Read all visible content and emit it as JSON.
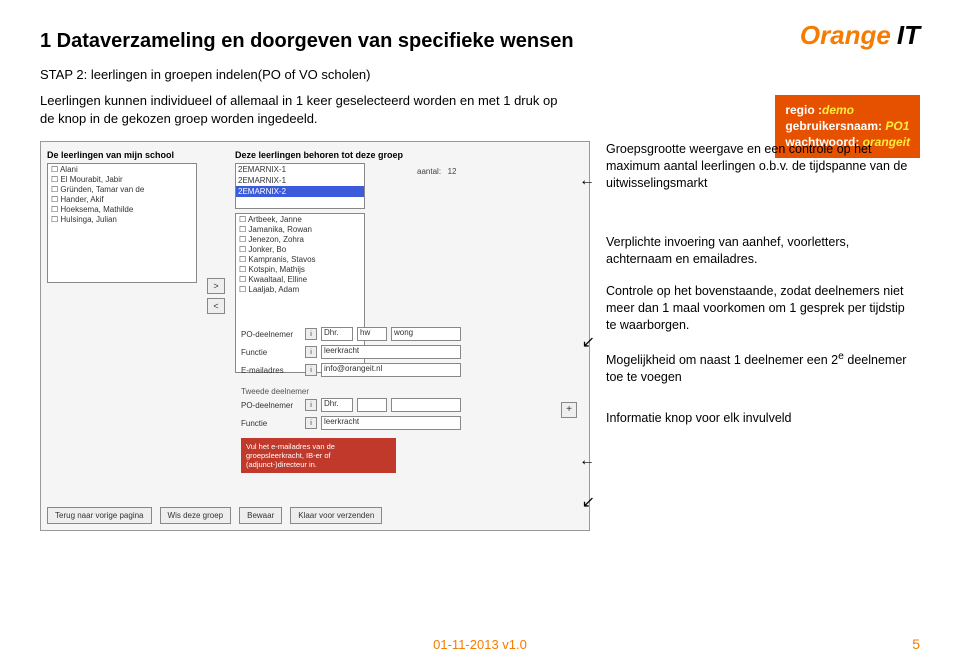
{
  "title": "1 Dataverzameling en doorgeven van specifieke wensen",
  "logo": {
    "orange": "Orange",
    "it": "IT"
  },
  "step": "STAP 2: leerlingen in groepen indelen(PO of VO scholen)",
  "intro": "Leerlingen kunnen individueel of allemaal in 1 keer geselecteerd worden en met 1 druk op de knop in de gekozen groep worden ingedeeld.",
  "region": {
    "line1_label": "regio :",
    "line1_val": "demo",
    "line2_label": "gebruikersnaam:",
    "line2_val": "PO1",
    "line3_label": "wachtwoord:",
    "line3_val": "orangeit"
  },
  "screenshot": {
    "left_label": "De leerlingen van mijn school",
    "right_label": "Deze leerlingen behoren tot deze groep",
    "left_list": [
      "Alani",
      "El Mourabit, Jabir",
      "Gründen, Tamar van de",
      "Hander, Akif",
      "Hoeksema, Mathilde",
      "Hulsinga, Julian"
    ],
    "group_list": [
      "2EMARNIX-1",
      "2EMARNIX-1",
      "2EMARNIX-2"
    ],
    "aantal_label": "aantal:",
    "aantal_val": "12",
    "right_list": [
      "Artbeek, Janne",
      "Jamanika, Rowan",
      "Jenezon, Zohra",
      "Jonker, Bo",
      "Kampranis, Stavos",
      "Kotspin, Mathijs",
      "Kwaaltaal, Elline",
      "Laaljab, Adam"
    ],
    "btn_right": ">",
    "btn_left": "<",
    "form": {
      "row1_label": "PO-deelnemer",
      "row1_sel": "Dhr.",
      "row1_v1": "hw",
      "row1_v2": "wong",
      "row2_label": "Functie",
      "row2_val": "leerkracht",
      "row3_label": "E-mailadres",
      "row3_val": "info@orangeit.nl",
      "sec2": "Tweede deelnemer",
      "row4_label": "PO-deelnemer",
      "row4_sel": "Dhr.",
      "row5_label": "Functie",
      "row5_val": "leerkracht",
      "red_note": "Vul het e-mailadres van de groepsleerkracht, IB-er of (adjunct-)directeur in.",
      "i": "i",
      "plus": "+"
    },
    "bottom": [
      "Terug naar vorige pagina",
      "Wis deze groep",
      "Bewaar",
      "Klaar voor verzenden"
    ]
  },
  "annotations": {
    "a1": "Groepsgrootte weergave en een controle op het maximum aantal leerlingen o.b.v. de tijdspanne van de uitwisselingsmarkt",
    "a2": "Verplichte invoering van aanhef, voorletters, achternaam en emailadres.",
    "a3": "Controle op het bovenstaande, zodat deelnemers niet meer dan 1 maal voorkomen om 1 gesprek per tijdstip te waarborgen.",
    "a4_p1": "Mogelijkheid om naast 1 deelnemer een 2",
    "a4_sup": "e",
    "a4_p2": " deelnemer toe te voegen",
    "a5": "Informatie knop voor elk invulveld"
  },
  "footer": {
    "date": "01-11-2013 v1.0",
    "page": "5"
  }
}
